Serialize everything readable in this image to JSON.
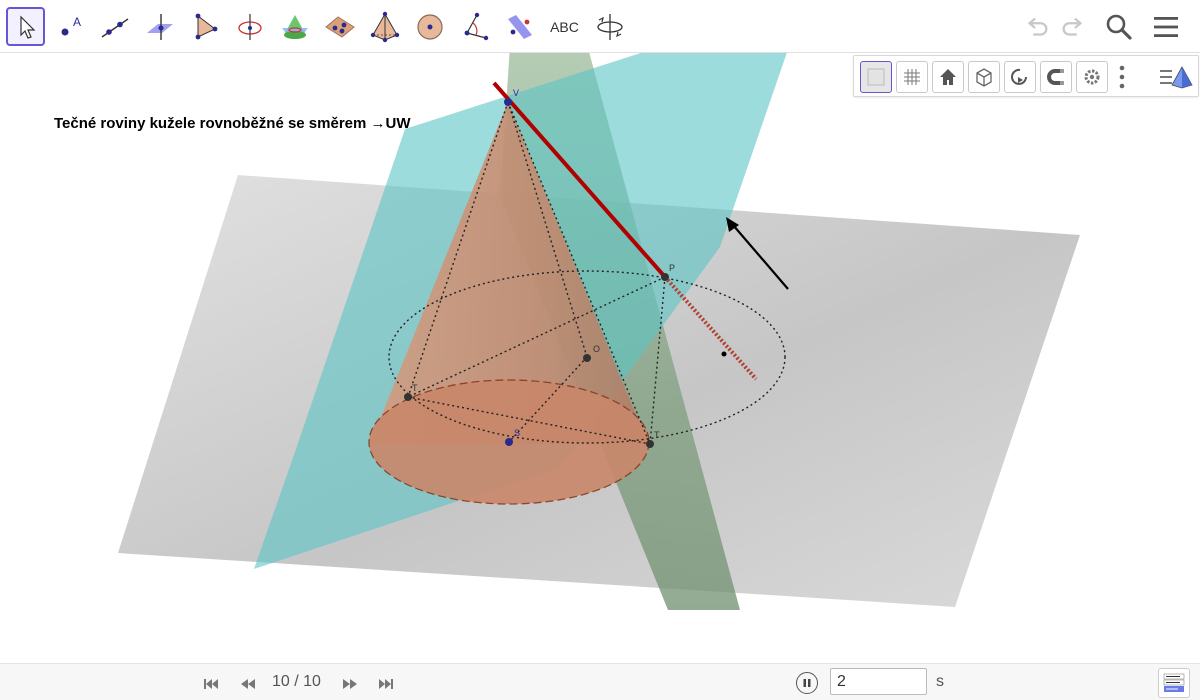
{
  "toolbar": {
    "tools": [
      {
        "name": "move",
        "icon": "move-arrow-icon",
        "selected": true
      },
      {
        "name": "point",
        "icon": "point-icon",
        "label": "A"
      },
      {
        "name": "line",
        "icon": "line-icon"
      },
      {
        "name": "perpendicular-line",
        "icon": "perpendicular-line-icon"
      },
      {
        "name": "pyramid",
        "icon": "pyramid-icon"
      },
      {
        "name": "circle-axis",
        "icon": "circle-axis-icon"
      },
      {
        "name": "intersect",
        "icon": "intersect-curve-icon"
      },
      {
        "name": "plane",
        "icon": "plane-three-points-icon"
      },
      {
        "name": "pyramid-solid",
        "icon": "pyramid-solid-icon"
      },
      {
        "name": "sphere",
        "icon": "sphere-icon"
      },
      {
        "name": "angle",
        "icon": "angle-icon"
      },
      {
        "name": "reflect",
        "icon": "reflect-plane-icon"
      },
      {
        "name": "text",
        "label": "ABC"
      },
      {
        "name": "rotate-view",
        "icon": "rotate-view-icon"
      }
    ],
    "undo_icon": "undo-icon",
    "redo_icon": "redo-icon",
    "search_icon": "search-icon",
    "menu_icon": "menu-icon"
  },
  "graphics": {
    "caption": "Tečné roviny kužele rovnoběžné se směrem →UW",
    "point_labels": {
      "V": "V",
      "P": "P",
      "T": "T",
      "S": "S",
      "T1": "T",
      "O": "O"
    }
  },
  "stylebar": {
    "buttons": [
      "axes-toggle-icon",
      "grid-icon",
      "home-icon",
      "cube-view-icon",
      "rotate-icon",
      "magnet-icon",
      "settings-icon",
      "more-vertical-icon",
      "perspective-menu-icon"
    ]
  },
  "bottom": {
    "slide_counter": "10 / 10",
    "speed_value": "2",
    "speed_unit": "s"
  },
  "colors": {
    "accent": "#6557d2",
    "cone": "#c97a5e",
    "plane_cyan": "#5cc4c4",
    "plane_gray": "#9a9a9a",
    "plane_green": "#5f8a5f",
    "line_red": "#b00000"
  }
}
